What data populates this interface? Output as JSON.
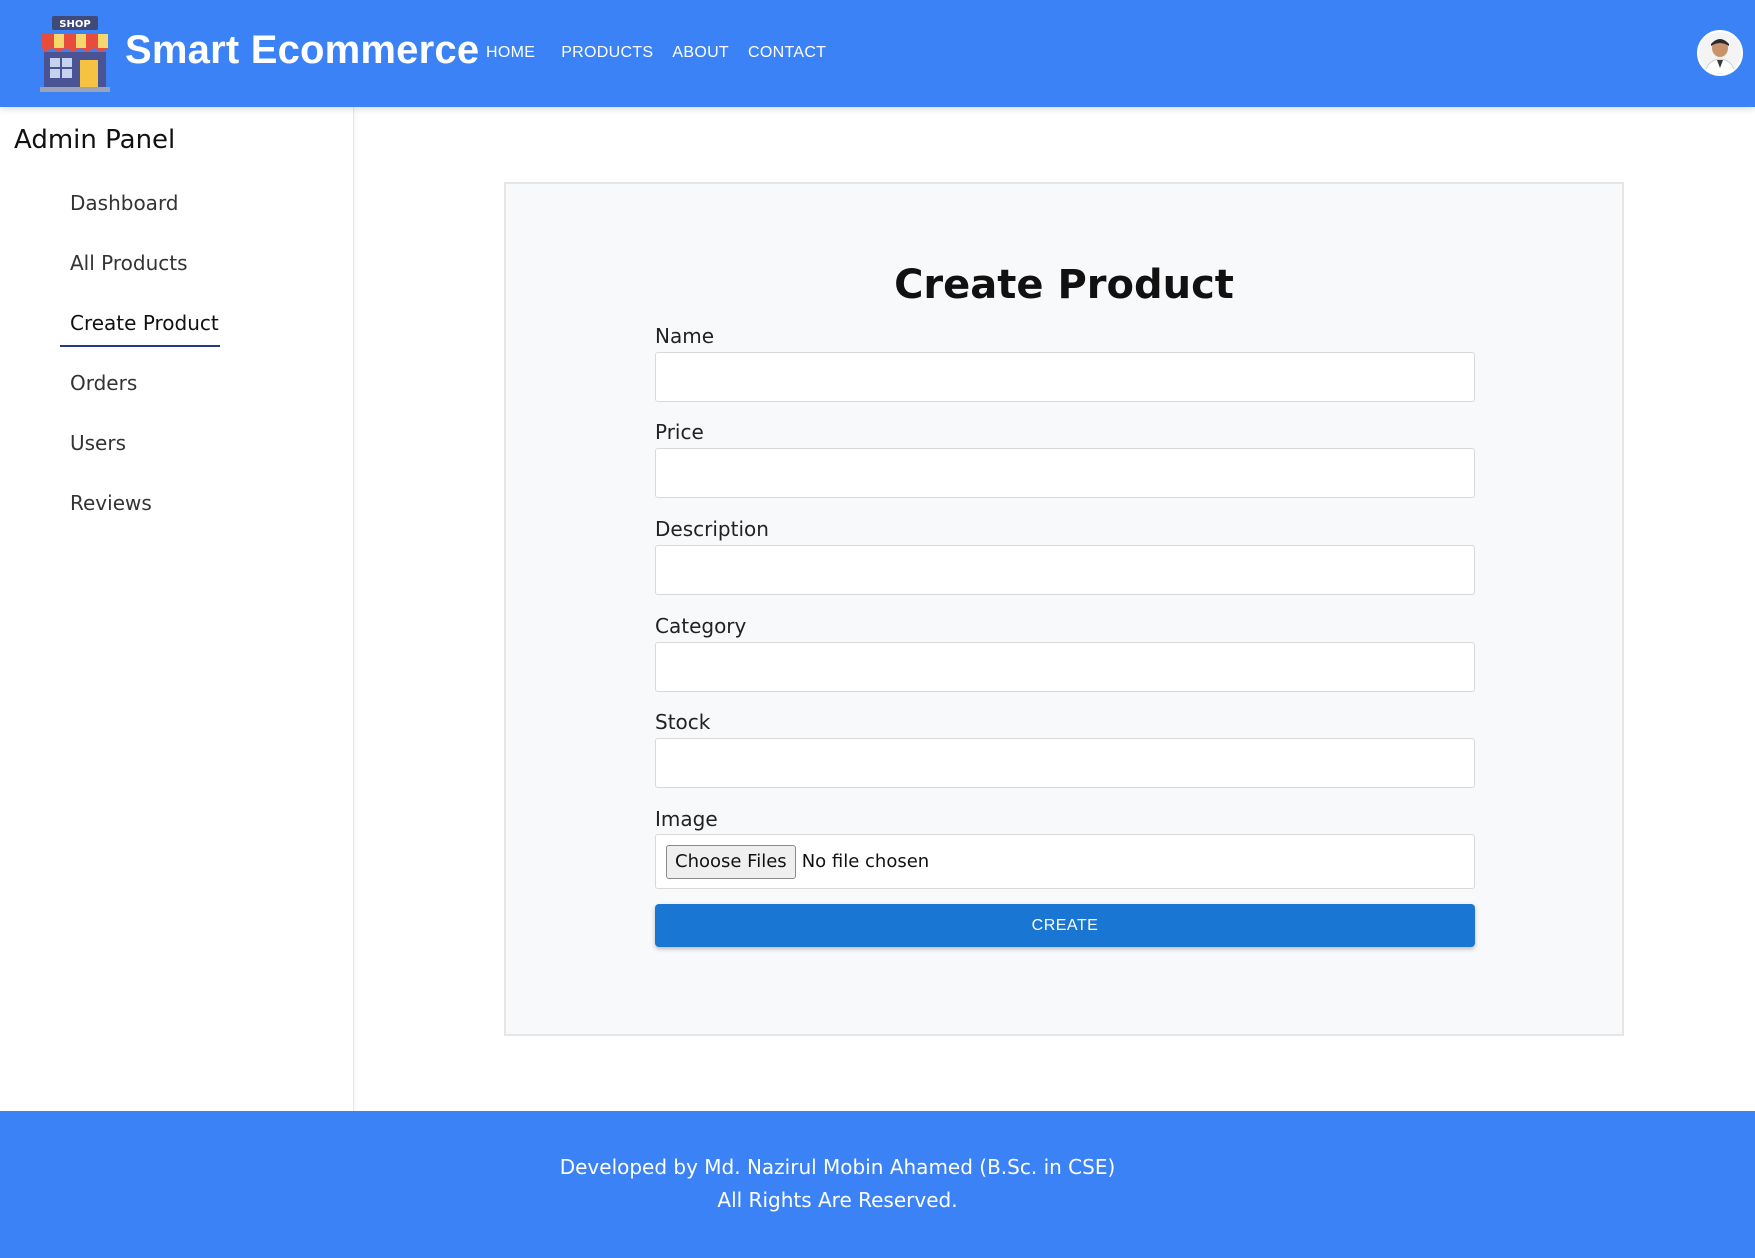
{
  "header": {
    "logo_sign": "SHOP",
    "brand": "Smart Ecommerce",
    "nav": [
      "HOME",
      "PRODUCTS",
      "ABOUT",
      "CONTACT"
    ],
    "colors": {
      "header_bg": "#3b82f6"
    }
  },
  "sidebar": {
    "title": "Admin Panel",
    "items": [
      {
        "label": "Dashboard"
      },
      {
        "label": "All Products"
      },
      {
        "label": "Create Product",
        "active": true
      },
      {
        "label": "Orders"
      },
      {
        "label": "Users"
      },
      {
        "label": "Reviews"
      }
    ]
  },
  "form": {
    "title": "Create Product",
    "fields": [
      {
        "label": "Name",
        "value": ""
      },
      {
        "label": "Price",
        "value": ""
      },
      {
        "label": "Description",
        "value": ""
      },
      {
        "label": "Category",
        "value": ""
      },
      {
        "label": "Stock",
        "value": ""
      }
    ],
    "image": {
      "label": "Image",
      "button": "Choose Files",
      "status": "No file chosen"
    },
    "submit": "CREATE",
    "colors": {
      "submit_bg": "#1976d2"
    }
  },
  "footer": {
    "line1": "Developed by Md. Nazirul Mobin Ahamed (B.Sc. in CSE)",
    "line2": "All Rights Are Reserved."
  }
}
